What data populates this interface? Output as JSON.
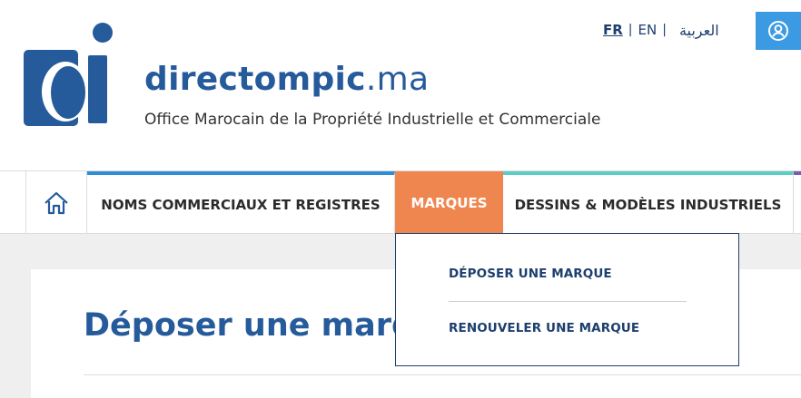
{
  "header": {
    "brand_bold": "directompic",
    "brand_light": ".ma",
    "tagline": "Office Marocain de la Propriété Industrielle et Commerciale",
    "logo_icon": "directompic-logo-icon"
  },
  "languages": {
    "fr": "FR",
    "en": "EN",
    "ar": "العربية",
    "separator": "|"
  },
  "account": {
    "icon": "user-account-icon"
  },
  "nav": {
    "home_icon": "home-icon",
    "items": [
      {
        "label": "NOMS COMMERCIAUX ET REGISTRES"
      },
      {
        "label": "MARQUES",
        "active": true
      },
      {
        "label": "DESSINS & MODÈLES INDUSTRIELS"
      }
    ]
  },
  "dropdown": {
    "items": [
      {
        "label": "DÉPOSER UNE MARQUE"
      },
      {
        "label": "RENOUVELER UNE MARQUE"
      }
    ]
  },
  "main": {
    "title": "Déposer une marque"
  },
  "colors": {
    "brand_blue": "#255a9b",
    "navy": "#1d3f6e",
    "active_orange": "#f0864f",
    "accent_blue": "#2e8fd6",
    "accent_teal": "#5ccdc4",
    "button_blue": "#3b9ae1"
  }
}
